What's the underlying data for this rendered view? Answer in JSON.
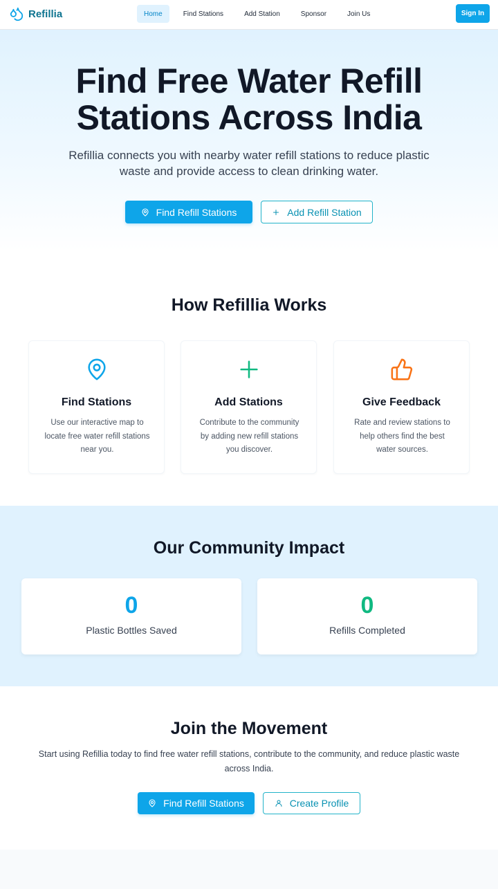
{
  "nav": {
    "brand": "Refillia",
    "links": [
      "Home",
      "Find Stations",
      "Add Station",
      "Sponsor",
      "Join Us"
    ],
    "active_link": "Home",
    "signin_label": "Sign In"
  },
  "hero": {
    "title_line1": "Find Free Water Refill",
    "title_line2": "Stations Across India",
    "subtitle": "Refillia connects you with nearby water refill stations to reduce plastic waste and provide access to clean drinking water.",
    "primary_button": "Find Refill Stations",
    "secondary_button": "Add Refill Station"
  },
  "how": {
    "title": "How Refillia Works",
    "cards": [
      {
        "icon": "map-pin-icon",
        "title": "Find Stations",
        "text": "Use our interactive map to locate free water refill stations near you.",
        "color": "#0ea5e9"
      },
      {
        "icon": "plus-icon",
        "title": "Add Stations",
        "text": "Contribute to the community by adding new refill stations you discover.",
        "color": "#10b981"
      },
      {
        "icon": "thumbs-up-icon",
        "title": "Give Feedback",
        "text": "Rate and review stations to help others find the best water sources.",
        "color": "#f97316"
      }
    ]
  },
  "impact": {
    "title": "Our Community Impact",
    "stats": [
      {
        "value": "0",
        "label": "Plastic Bottles Saved",
        "color": "#0ea5e9"
      },
      {
        "value": "0",
        "label": "Refills Completed",
        "color": "#10b981"
      }
    ]
  },
  "join": {
    "title": "Join the Movement",
    "text": "Start using Refillia today to find free water refill stations, contribute to the community, and reduce plastic waste across India.",
    "primary_button": "Find Refill Stations",
    "secondary_button": "Create Profile"
  },
  "colors": {
    "accent": "#0ea5e9",
    "teal": "#0891b2",
    "green": "#10b981",
    "orange": "#f97316"
  }
}
